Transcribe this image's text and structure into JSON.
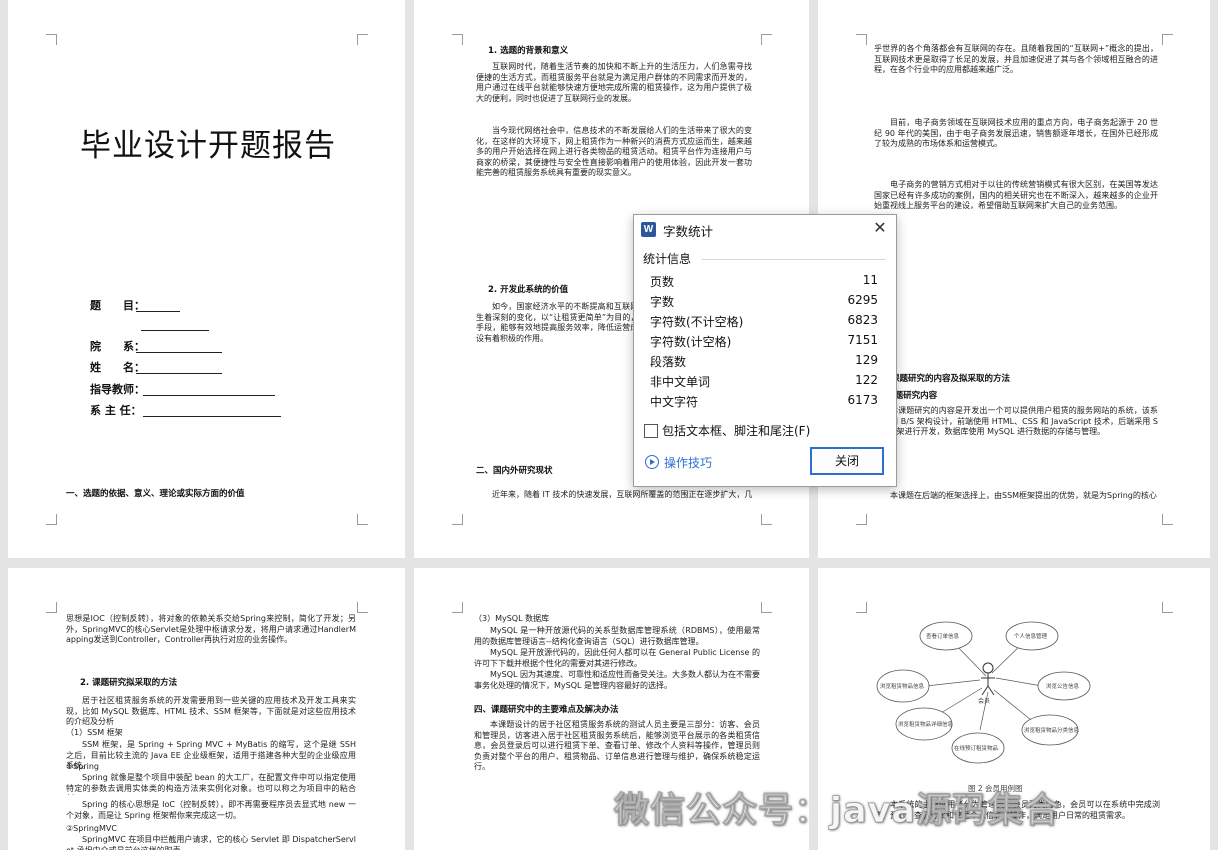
{
  "page1": {
    "title": "毕业设计开题报告",
    "fields": {
      "topic": "题　　目：",
      "dept": "院　　系：",
      "name": "姓　　名：",
      "advisor": "指导教师：",
      "dean": "系 主 任："
    },
    "section": "一、选题的依据、意义、理论或实际方面的价值"
  },
  "page2": {
    "heading1": "1. 选题的背景和意义",
    "para1": "互联网时代，随着生活节奏的加快和不断上升的生活压力，人们急需寻找便捷的生活方式，而租赁服务平台就是为满足用户群体的不同需求而开发的，用户通过在线平台就能够快速方便地完成所需的租赁操作，这为用户提供了极大的便利，同时也促进了互联网行业的发展。",
    "para2": "当今现代网络社会中，信息技术的不断发展给人们的生活带来了很大的变化，在这样的大环境下，网上租赁作为一种新兴的消费方式应运而生，越来越多的用户开始选择在网上进行各类物品的租赁活动。租赁平台作为连接用户与商家的桥梁，其便捷性与安全性直接影响着用户的使用体验，因此开发一套功能完善的租赁服务系统具有重要的现实意义。",
    "heading2": "2. 开发此系统的价值",
    "para3": "如今，国家经济水平的不断提高和互联网的普及，人们的消费观念也在发生着深刻的变化，以“让租赁更简单”为目的，在租赁系统中引入现代化的管理手段，能够有效地提高服务效率，降低运营成本，这对于推动行业的信息化建设有着积极的作用。",
    "heading3": "二、国内外研究现状",
    "para4": "近年来，随着 IT 技术的快速发展，互联网所覆盖的范围正在逐步扩大，几"
  },
  "page3": {
    "para1": "乎世界的各个角落都会有互联网的存在。且随着我国的“互联网+”概念的提出，互联网技术更是取得了长足的发展，并且加速促进了其与各个领域相互融合的进程，在各个行业中的应用都越来越广泛。",
    "para2": "目前，电子商务领域在互联网技术应用的重点方向，电子商务起源于 20 世纪 90 年代的美国，由于电子商务发展迅速，销售额逐年增长，在国外已经形成了较为成熟的市场体系和运营模式。",
    "para3": "电子商务的营销方式相对于以往的传统营销模式有很大区别，在美国等发达国家已经有许多成功的案例，国内的相关研究也在不断深入，越来越多的企业开始重视线上服务平台的建设，希望借助互联网来扩大自己的业务范围。",
    "heading1": "三、课题研究的内容及拟采取的方法",
    "heading2": "1. 课题研究内容",
    "para4": "本课题研究的内容是开发出一个可以提供用户租赁的服务网站的系统，该系统采用 B/S 架构设计，前端使用 HTML、CSS 和 JavaScript 技术，后端采用 SSM 框架进行开发，数据库使用 MySQL 进行数据的存储与管理。",
    "para5": "本课题在后端的框架选择上，由SSM框架提出的优势，就是为Spring的核心"
  },
  "page4": {
    "para1": "思想是IOC（控制反转），将对象的依赖关系交给Spring来控制，简化了开发；另外，SpringMVC的核心Servlet是处理中枢请求分发，将用户请求通过HandlerMapping发送到Controller，Controller再执行对应的业务操作。",
    "heading1": "2. 课题研究拟采取的方法",
    "para2": "居于社区租赁服务系统的开发需要用到一些关键的应用技术及开发工具来实现，比如 MySQL 数据库、HTML 技术、SSM 框架等，下面就是对这些应用技术的介绍及分析",
    "sub1": "（1）SSM 框架",
    "para3": "SSM 框架，是 Spring + Spring MVC + MyBatis 的缩写，这个是继 SSH 之后，目前比较主流的 Java EE 企业级框架，适用于搭建各种大型的企业级应用系统。",
    "sub2": "①Spring",
    "para4": "Spring 就像是整个项目中装配 bean 的大工厂，在配置文件中可以指定使用特定的参数去调用实体类的构造方法来实例化对象。也可以称之为项目中的粘合剂。",
    "para5": "Spring 的核心思想是 IoC（控制反转），即不再需要程序员去显式地 new 一个对象，而是让 Spring 框架帮你来完成这一切。",
    "sub3": "②SpringMVC",
    "para6": "SpringMVC 在项目中拦截用户请求，它的核心 Servlet 即 DispatcherServlet 承担中介或是前台这样的职责"
  },
  "page5": {
    "sub1": "（3）MySQL 数据库",
    "para1": "MySQL 是一种开放源代码的关系型数据库管理系统（RDBMS），使用最常用的数据库管理语言--结构化查询语言（SQL）进行数据库管理。",
    "para2": "MySQL 是开放源代码的，因此任何人都可以在 General Public License 的许可下下载并根据个性化的需要对其进行修改。",
    "para3": "MySQL 因为其速度、可靠性和适应性而备受关注。大多数人都认为在不需要事务化处理的情况下，MySQL 是管理内容最好的选择。",
    "heading1": "四、课题研究中的主要难点及解决办法",
    "para4": "本课题设计的居于社区租赁服务系统的测试人员主要是三部分：访客、会员和管理员，访客进入居于社区租赁服务系统后，能够浏览平台展示的各类租赁信息，会员登录后可以进行租赁下单、查看订单、修改个人资料等操作，管理员则负责对整个平台的用户、租赁物品、订单信息进行管理与维护，确保系统稳定运行。"
  },
  "page6": {
    "diagram": {
      "center": "会员",
      "nodes": [
        "查看订单信息",
        "个人信息管理",
        "浏览公告信息",
        "浏览租赁物品信息",
        "浏览租赁物品分类信息",
        "浏览租赁物品详细信息",
        "在线预订租赁物品"
      ],
      "caption": "图 2  会员用例图"
    },
    "para1": "本系统的主要使用者分为管理员和会员两类角色，会员可以在系统中完成浏览、预订、查看订单和管理个人信息等操作，满足用户日常的租赁需求。"
  },
  "dialog": {
    "icon": "W",
    "title": "字数统计",
    "section": "统计信息",
    "rows": [
      {
        "label": "页数",
        "value": "11"
      },
      {
        "label": "字数",
        "value": "6295"
      },
      {
        "label": "字符数(不计空格)",
        "value": "6823"
      },
      {
        "label": "字符数(计空格)",
        "value": "7151"
      },
      {
        "label": "段落数",
        "value": "129"
      },
      {
        "label": "非中文单词",
        "value": "122"
      },
      {
        "label": "中文字符",
        "value": "6173"
      }
    ],
    "checkbox_label": "包括文本框、脚注和尾注(F)",
    "tips": "操作技巧",
    "close_button": "关闭"
  },
  "watermark": "微信公众号：java源码集合"
}
